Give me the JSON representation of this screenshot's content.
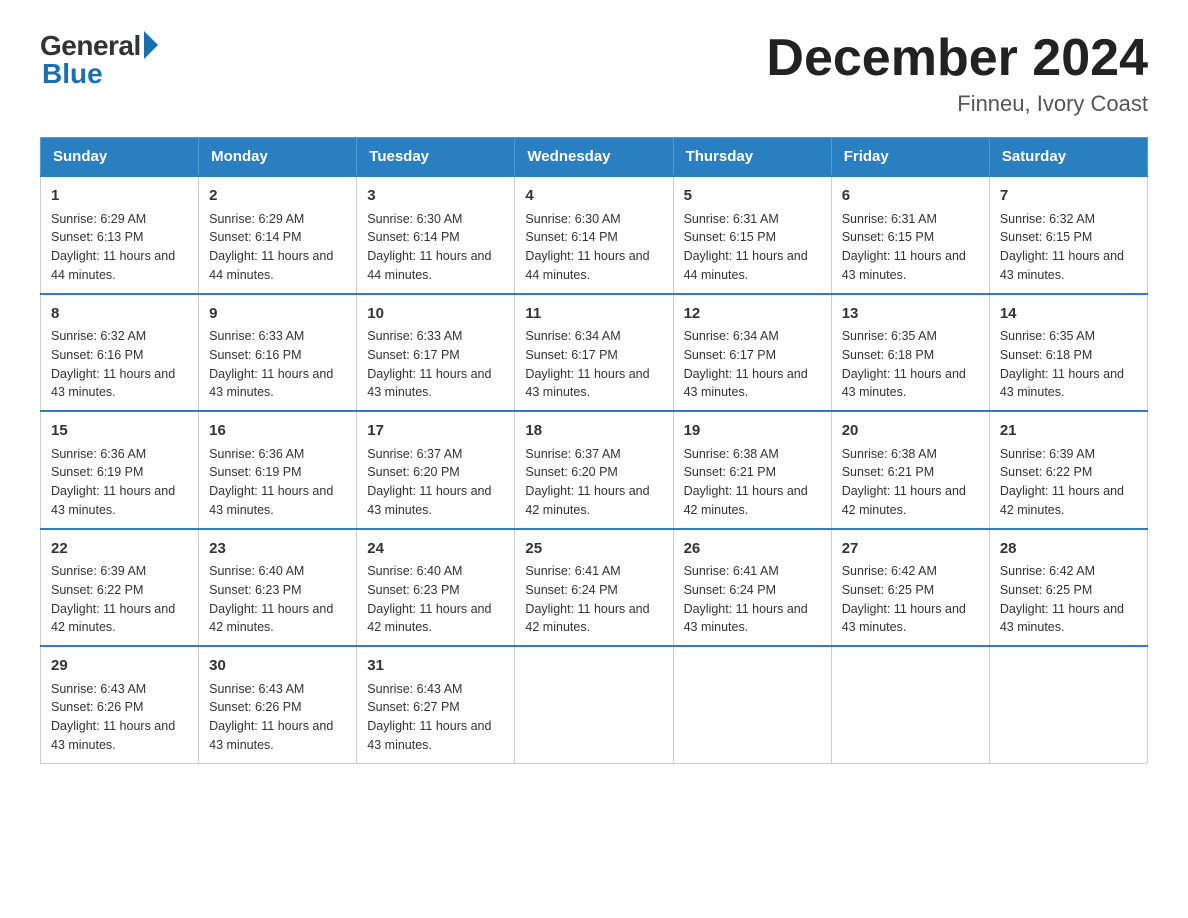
{
  "logo": {
    "general": "General",
    "blue": "Blue"
  },
  "title": "December 2024",
  "location": "Finneu, Ivory Coast",
  "days_of_week": [
    "Sunday",
    "Monday",
    "Tuesday",
    "Wednesday",
    "Thursday",
    "Friday",
    "Saturday"
  ],
  "weeks": [
    [
      {
        "day": "1",
        "sunrise": "6:29 AM",
        "sunset": "6:13 PM",
        "daylight": "11 hours and 44 minutes."
      },
      {
        "day": "2",
        "sunrise": "6:29 AM",
        "sunset": "6:14 PM",
        "daylight": "11 hours and 44 minutes."
      },
      {
        "day": "3",
        "sunrise": "6:30 AM",
        "sunset": "6:14 PM",
        "daylight": "11 hours and 44 minutes."
      },
      {
        "day": "4",
        "sunrise": "6:30 AM",
        "sunset": "6:14 PM",
        "daylight": "11 hours and 44 minutes."
      },
      {
        "day": "5",
        "sunrise": "6:31 AM",
        "sunset": "6:15 PM",
        "daylight": "11 hours and 44 minutes."
      },
      {
        "day": "6",
        "sunrise": "6:31 AM",
        "sunset": "6:15 PM",
        "daylight": "11 hours and 43 minutes."
      },
      {
        "day": "7",
        "sunrise": "6:32 AM",
        "sunset": "6:15 PM",
        "daylight": "11 hours and 43 minutes."
      }
    ],
    [
      {
        "day": "8",
        "sunrise": "6:32 AM",
        "sunset": "6:16 PM",
        "daylight": "11 hours and 43 minutes."
      },
      {
        "day": "9",
        "sunrise": "6:33 AM",
        "sunset": "6:16 PM",
        "daylight": "11 hours and 43 minutes."
      },
      {
        "day": "10",
        "sunrise": "6:33 AM",
        "sunset": "6:17 PM",
        "daylight": "11 hours and 43 minutes."
      },
      {
        "day": "11",
        "sunrise": "6:34 AM",
        "sunset": "6:17 PM",
        "daylight": "11 hours and 43 minutes."
      },
      {
        "day": "12",
        "sunrise": "6:34 AM",
        "sunset": "6:17 PM",
        "daylight": "11 hours and 43 minutes."
      },
      {
        "day": "13",
        "sunrise": "6:35 AM",
        "sunset": "6:18 PM",
        "daylight": "11 hours and 43 minutes."
      },
      {
        "day": "14",
        "sunrise": "6:35 AM",
        "sunset": "6:18 PM",
        "daylight": "11 hours and 43 minutes."
      }
    ],
    [
      {
        "day": "15",
        "sunrise": "6:36 AM",
        "sunset": "6:19 PM",
        "daylight": "11 hours and 43 minutes."
      },
      {
        "day": "16",
        "sunrise": "6:36 AM",
        "sunset": "6:19 PM",
        "daylight": "11 hours and 43 minutes."
      },
      {
        "day": "17",
        "sunrise": "6:37 AM",
        "sunset": "6:20 PM",
        "daylight": "11 hours and 43 minutes."
      },
      {
        "day": "18",
        "sunrise": "6:37 AM",
        "sunset": "6:20 PM",
        "daylight": "11 hours and 42 minutes."
      },
      {
        "day": "19",
        "sunrise": "6:38 AM",
        "sunset": "6:21 PM",
        "daylight": "11 hours and 42 minutes."
      },
      {
        "day": "20",
        "sunrise": "6:38 AM",
        "sunset": "6:21 PM",
        "daylight": "11 hours and 42 minutes."
      },
      {
        "day": "21",
        "sunrise": "6:39 AM",
        "sunset": "6:22 PM",
        "daylight": "11 hours and 42 minutes."
      }
    ],
    [
      {
        "day": "22",
        "sunrise": "6:39 AM",
        "sunset": "6:22 PM",
        "daylight": "11 hours and 42 minutes."
      },
      {
        "day": "23",
        "sunrise": "6:40 AM",
        "sunset": "6:23 PM",
        "daylight": "11 hours and 42 minutes."
      },
      {
        "day": "24",
        "sunrise": "6:40 AM",
        "sunset": "6:23 PM",
        "daylight": "11 hours and 42 minutes."
      },
      {
        "day": "25",
        "sunrise": "6:41 AM",
        "sunset": "6:24 PM",
        "daylight": "11 hours and 42 minutes."
      },
      {
        "day": "26",
        "sunrise": "6:41 AM",
        "sunset": "6:24 PM",
        "daylight": "11 hours and 43 minutes."
      },
      {
        "day": "27",
        "sunrise": "6:42 AM",
        "sunset": "6:25 PM",
        "daylight": "11 hours and 43 minutes."
      },
      {
        "day": "28",
        "sunrise": "6:42 AM",
        "sunset": "6:25 PM",
        "daylight": "11 hours and 43 minutes."
      }
    ],
    [
      {
        "day": "29",
        "sunrise": "6:43 AM",
        "sunset": "6:26 PM",
        "daylight": "11 hours and 43 minutes."
      },
      {
        "day": "30",
        "sunrise": "6:43 AM",
        "sunset": "6:26 PM",
        "daylight": "11 hours and 43 minutes."
      },
      {
        "day": "31",
        "sunrise": "6:43 AM",
        "sunset": "6:27 PM",
        "daylight": "11 hours and 43 minutes."
      },
      null,
      null,
      null,
      null
    ]
  ]
}
